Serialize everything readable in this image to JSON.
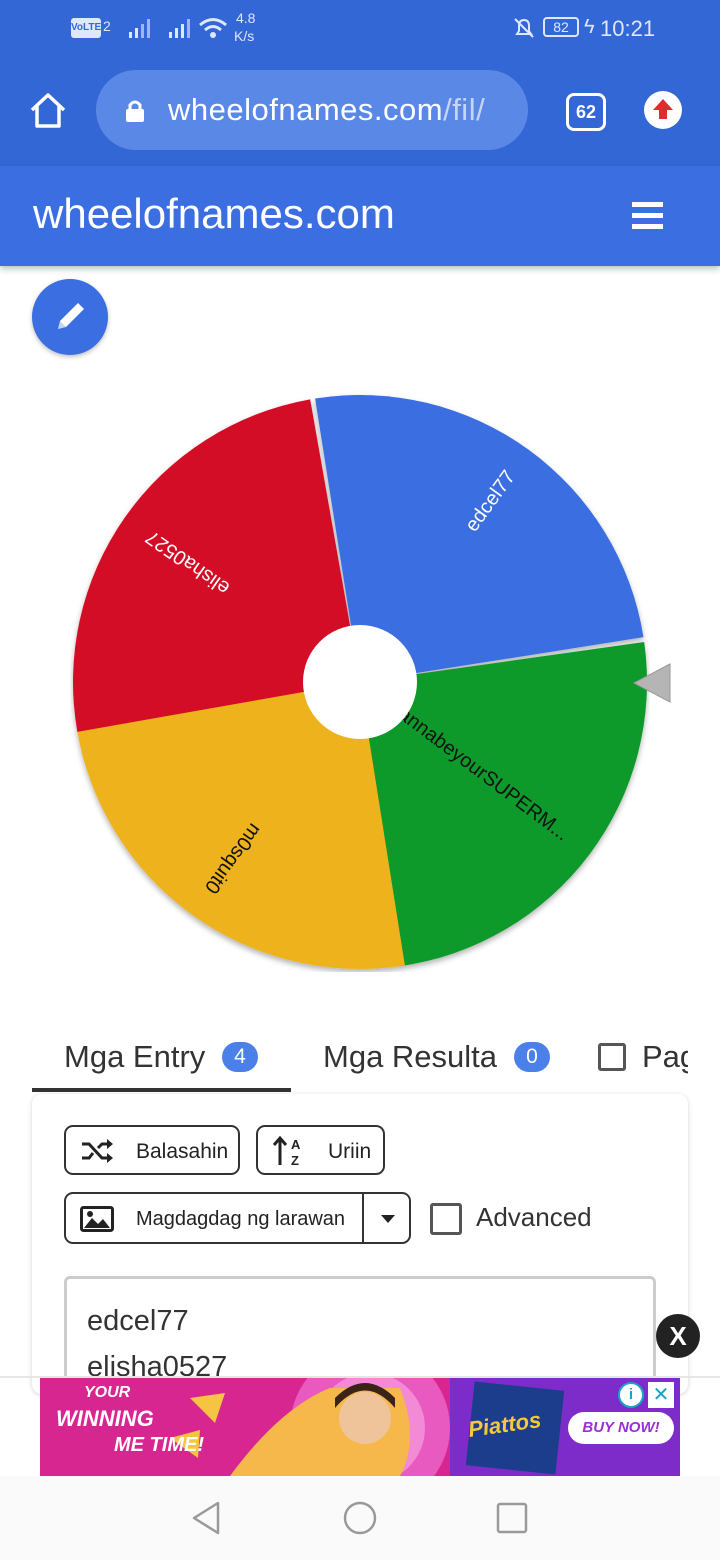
{
  "status_bar": {
    "net_badge": "VoLTE",
    "sim_index": "2",
    "speed_value": "4.8",
    "speed_unit": "K/s",
    "battery": "82",
    "time": "10:21"
  },
  "browser": {
    "url_main": "wheelofnames.com",
    "url_rest": "/fil/",
    "tab_count": "62"
  },
  "app": {
    "title": "wheelofnames.com"
  },
  "wheel": {
    "slices": [
      {
        "label": "edcel77",
        "color": "#3a6ee0"
      },
      {
        "label": "wannabeyourSUPERM...",
        "color": "#0a9a2a"
      },
      {
        "label": "m0squit0",
        "color": "#eeb31a"
      },
      {
        "label": "elisha0527",
        "color": "#d40f26"
      }
    ]
  },
  "tabs": [
    {
      "label": "Mga Entry",
      "count": "4"
    },
    {
      "label": "Mga Resulta",
      "count": "0"
    },
    {
      "label": "Pag"
    }
  ],
  "controls": {
    "shuffle_label": "Balasahin",
    "sort_label": "Uriin",
    "add_image_label": "Magdagdag ng larawan",
    "advanced_label": "Advanced"
  },
  "entries": [
    "edcel77",
    "elisha0527"
  ],
  "ad": {
    "close_label": "X",
    "headline_1": "YOUR",
    "headline_2": "WINNING",
    "headline_3": "ME TIME!",
    "brand": "Piattos",
    "cta": "BUY NOW!",
    "info_icon": "i",
    "x_icon": "✕"
  }
}
